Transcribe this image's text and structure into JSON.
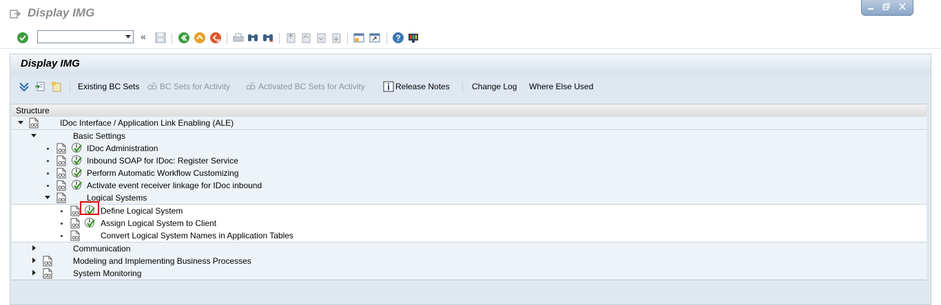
{
  "window": {
    "title": "Display IMG",
    "controls": [
      "minimize-icon",
      "restore-icon",
      "close-icon"
    ]
  },
  "toolbar": {
    "command_field_value": "",
    "chevron": "«",
    "icons": [
      "enter-icon",
      "save-icon",
      "back-icon",
      "exit-icon",
      "cancel-icon",
      "print-icon",
      "find-icon",
      "find-next-icon",
      "first-page-icon",
      "previous-page-icon",
      "next-page-icon",
      "last-page-icon",
      "create-session-icon",
      "create-shortcut-icon",
      "help-icon",
      "customize-layout-icon"
    ]
  },
  "app": {
    "title": "Display IMG",
    "buttons": {
      "existing_bc_sets": "Existing BC Sets",
      "bc_sets_for_activity": "BC Sets for Activity",
      "activated_bc_sets": "Activated BC Sets for Activity",
      "release_notes": "Release Notes",
      "change_log": "Change Log",
      "where_else_used": "Where Else Used"
    }
  },
  "tree": {
    "header": "Structure",
    "root": "IDoc Interface / Application Link Enabling (ALE)",
    "basic_settings": "Basic Settings",
    "basic_items": [
      "IDoc Administration",
      "Inbound SOAP for IDoc: Register Service",
      "Perform Automatic Workflow Customizing",
      "Activate event receiver linkage for IDoc inbound"
    ],
    "logical_systems": "Logical Systems",
    "logical_items": [
      "Define Logical System",
      "Assign Logical System to Client",
      "Convert Logical System Names in Application Tables"
    ],
    "communication": "Communication",
    "modeling": "Modeling and Implementing Business Processes",
    "monitoring": "System Monitoring"
  },
  "colors": {
    "app_background": "#dfe8f1",
    "highlight": "#e00000",
    "exec_green": "#3a9a2a"
  }
}
